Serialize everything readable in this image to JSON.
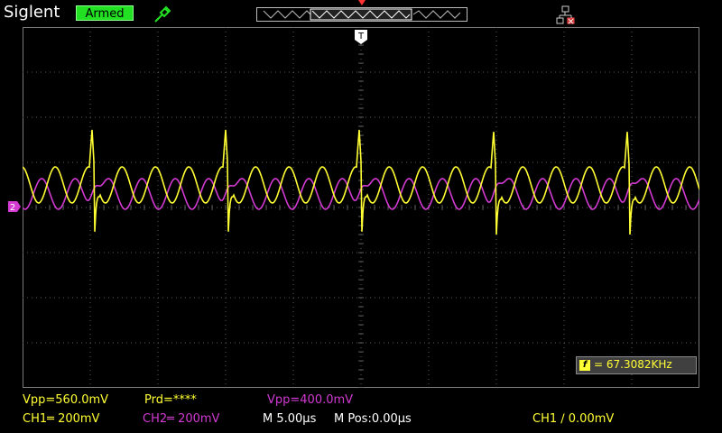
{
  "header": {
    "brand": "Siglent",
    "status": "Armed",
    "trigger_marker_top": "T"
  },
  "display": {
    "ground_marker": "2",
    "trigger_cursor": "T"
  },
  "frequency_counter": {
    "icon": "f",
    "value": "= 67.3082KHz"
  },
  "measurements": {
    "ch1_vpp": "Vpp=560.0mV",
    "period": "Prd=****",
    "ch2_vpp": "Vpp=400.0mV"
  },
  "status_bar": {
    "ch1_scale": "CH1═ 200mV",
    "ch2_scale": "CH2═ 200mV",
    "timebase": "M 5.00µs",
    "horizontal_pos": "M Pos:0.00µs",
    "trigger": "CH1 ∕ 0.00mV"
  },
  "colors": {
    "ch1": "#ffff33",
    "ch2": "#d23ad2",
    "grid": "#5a5a5a",
    "status_armed": "#22e022"
  }
}
